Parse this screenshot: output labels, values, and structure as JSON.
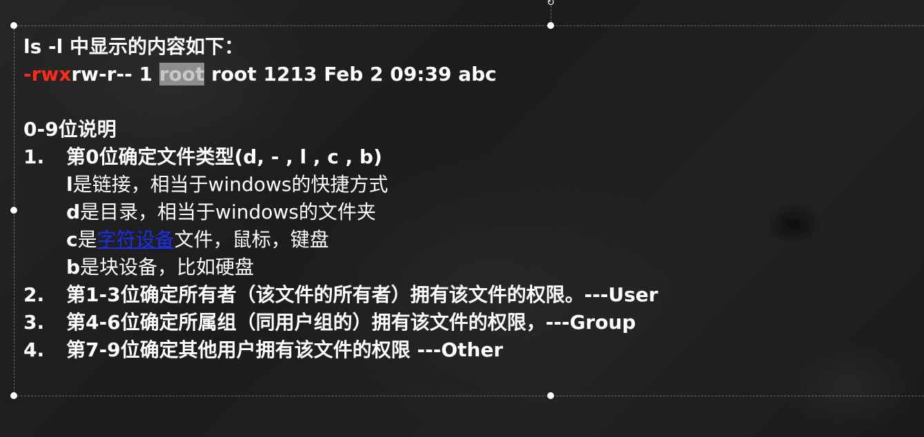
{
  "slide": {
    "heading": "ls  -l 中显示的内容如下：",
    "perm_line": {
      "dash": "-",
      "rwx": "rwx",
      "rest": "rw-r-- 1 ",
      "owner": "root",
      "tail": " root 1213 Feb 2 09:39 abc"
    },
    "section_title": "0-9位说明",
    "items": [
      {
        "num": "1.",
        "text": "第0位确定文件类型(d, - , l , c , b)"
      },
      {
        "num": "2.",
        "text": "第1-3位确定所有者（该文件的所有者）拥有该文件的权限。---User"
      },
      {
        "num": "3.",
        "text": "第4-6位确定所属组（同用户组的）拥有该文件的权限，---Group"
      },
      {
        "num": "4.",
        "text": "第7-9位确定其他用户拥有该文件的权限 ---Other"
      }
    ],
    "sub_items": {
      "l": {
        "letter": "l",
        "text": "是链接，相当于windows的快捷方式"
      },
      "d": {
        "letter": "d",
        "text": "是目录，相当于windows的文件夹"
      },
      "c": {
        "letter": "c",
        "pre": "是",
        "link": "字符设备",
        "post": "文件，鼠标，键盘"
      },
      "b": {
        "letter": "b",
        "text": "是块设备，比如硬盘"
      }
    }
  },
  "rotate_icon": "rotate-icon"
}
